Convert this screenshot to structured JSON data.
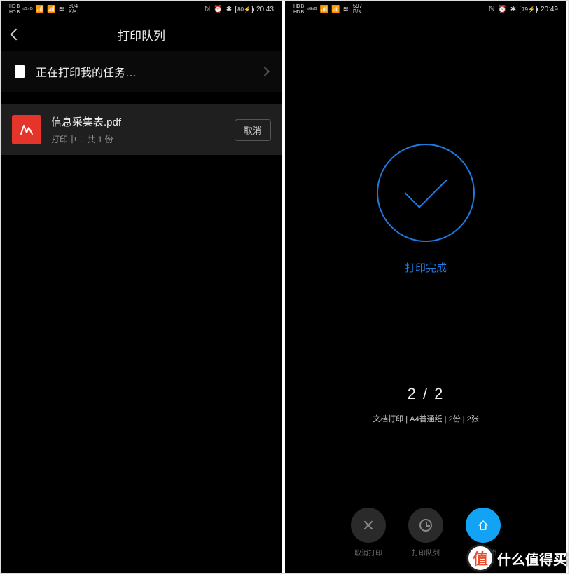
{
  "left": {
    "status": {
      "speed_value": "304",
      "speed_unit": "K/s",
      "battery": "80",
      "time": "20:43"
    },
    "header": {
      "title": "打印队列"
    },
    "job": {
      "label": "正在打印我的任务…"
    },
    "file": {
      "name": "信息采集表.pdf",
      "status": "打印中… 共 1 份",
      "cancel": "取消"
    }
  },
  "right": {
    "status": {
      "speed_value": "597",
      "speed_unit": "B/s",
      "battery": "79",
      "time": "20:49"
    },
    "success": {
      "text": "打印完成"
    },
    "counts": {
      "big": "2 / 2",
      "detail": "文档打印  |  A4普通纸  |  2份  |  2张"
    },
    "buttons": {
      "cancel": "取消打印",
      "queue": "打印队列",
      "home": "返回首页"
    }
  },
  "watermark": "什么值得买"
}
